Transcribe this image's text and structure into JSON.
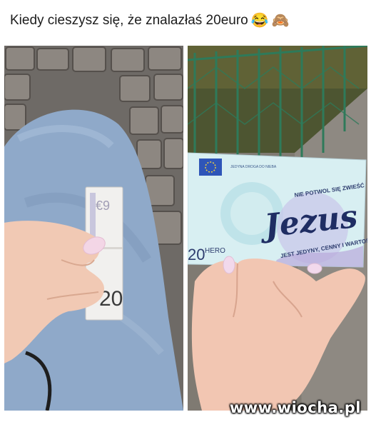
{
  "caption": {
    "text": "Kiedy cieszysz się, że znalazłaś 20euro",
    "emoji_1": "😂",
    "emoji_2": "🙈"
  },
  "left_photo": {
    "banknote_value": "20"
  },
  "right_photo": {
    "top_strip": "JEDYNA DROGA DO NIEBA",
    "phrase_top": "NIE POTWOL SIĘ ZWIEŚĆ",
    "brand": "Jezus",
    "phrase_bottom": "JEST JEDYNY, CENNY I WARTOŚCIOWY",
    "value": "20",
    "hero": "HERO"
  },
  "watermark": "www.wiocha.pl"
}
